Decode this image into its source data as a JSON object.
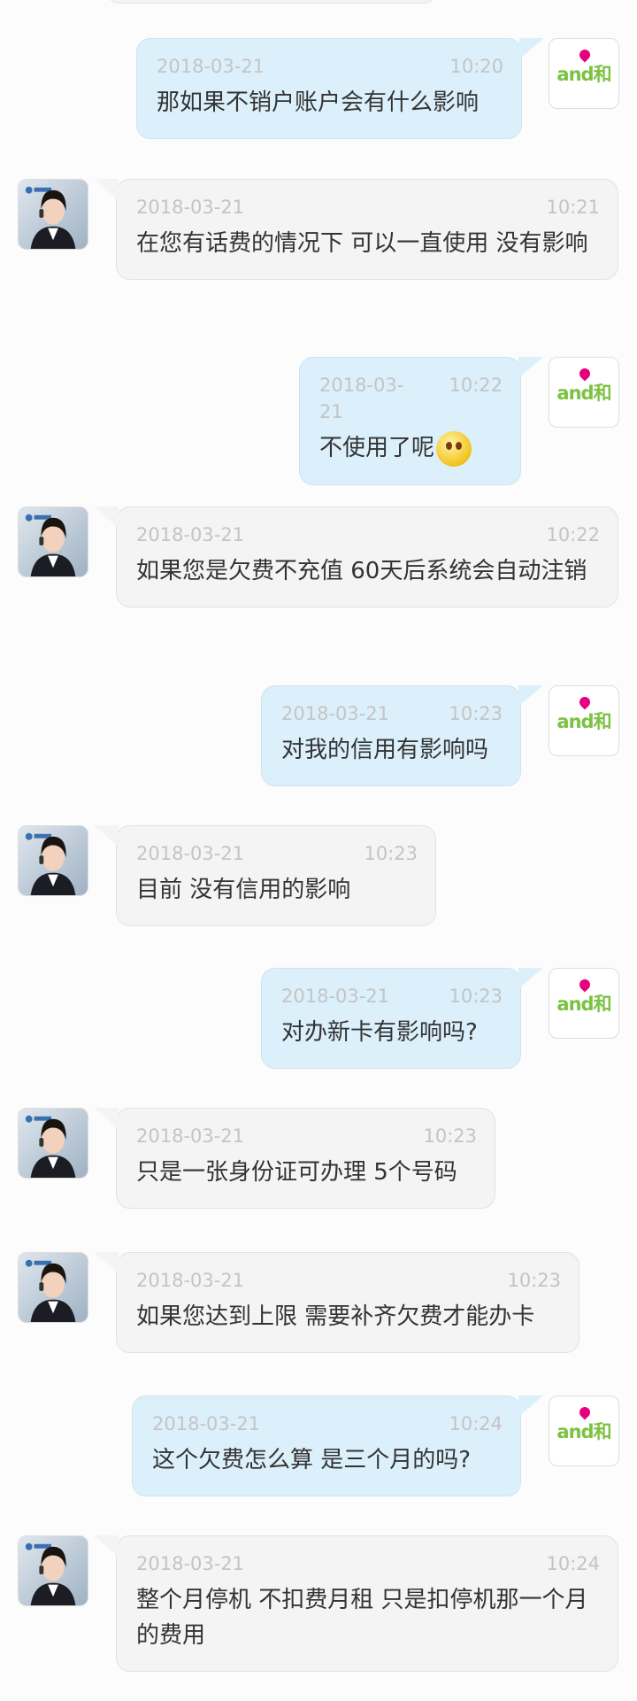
{
  "brand_avatar_text": "and和",
  "colors": {
    "user_bubble": "#dcf0fb",
    "agent_bubble": "#f4f4f4",
    "brand_green": "#7cc242",
    "brand_pink": "#e6007e"
  },
  "messages": [
    {
      "sender": "user",
      "date": "2018-03-21",
      "time": "10:20",
      "text": "那如果不销户账户会有什么影响"
    },
    {
      "sender": "agent",
      "date": "2018-03-21",
      "time": "10:21",
      "text": "在您有话费的情况下 可以一直使用 没有影响"
    },
    {
      "sender": "user",
      "date": "2018-03-21",
      "time": "10:22",
      "text": "不使用了呢",
      "emoji": "smile-emoji"
    },
    {
      "sender": "agent",
      "date": "2018-03-21",
      "time": "10:22",
      "text": "如果您是欠费不充值 60天后系统会自动注销"
    },
    {
      "sender": "user",
      "date": "2018-03-21",
      "time": "10:23",
      "text": "对我的信用有影响吗"
    },
    {
      "sender": "agent",
      "date": "2018-03-21",
      "time": "10:23",
      "text": "目前 没有信用的影响"
    },
    {
      "sender": "user",
      "date": "2018-03-21",
      "time": "10:23",
      "text": "对办新卡有影响吗?"
    },
    {
      "sender": "agent",
      "date": "2018-03-21",
      "time": "10:23",
      "text": "只是一张身份证可办理 5个号码"
    },
    {
      "sender": "agent",
      "date": "2018-03-21",
      "time": "10:23",
      "text": "如果您达到上限 需要补齐欠费才能办卡"
    },
    {
      "sender": "user",
      "date": "2018-03-21",
      "time": "10:24",
      "text": "这个欠费怎么算 是三个月的吗?"
    },
    {
      "sender": "agent",
      "date": "2018-03-21",
      "time": "10:24",
      "text": "整个月停机 不扣费月租 只是扣停机那一个月的费用"
    }
  ]
}
